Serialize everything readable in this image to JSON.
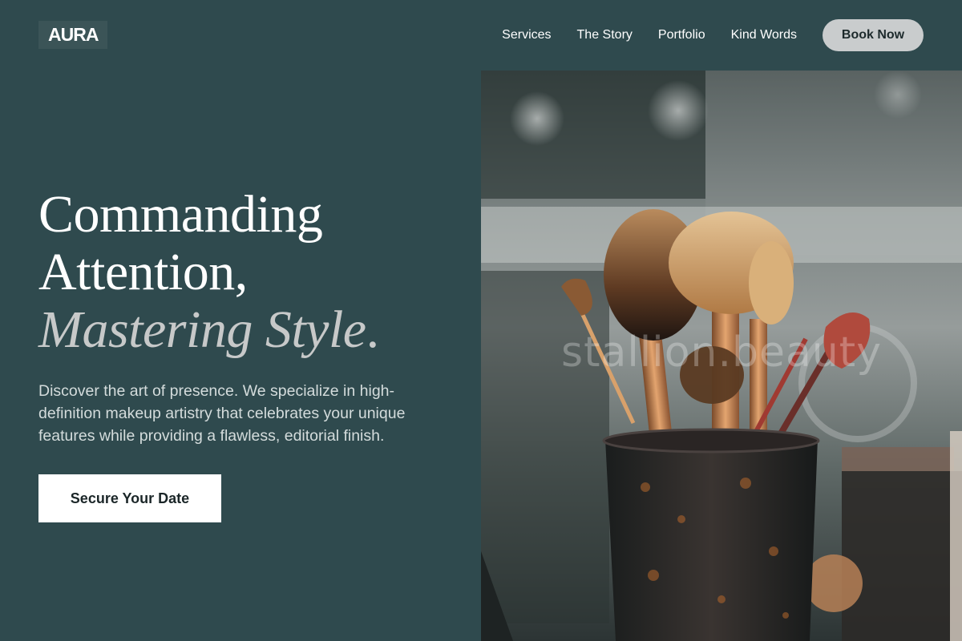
{
  "brand": {
    "logo_text": "AURA"
  },
  "nav": {
    "links": [
      "Services",
      "The Story",
      "Portfolio",
      "Kind Words"
    ],
    "cta_label": "Book Now"
  },
  "hero": {
    "headline_line1": "Commanding",
    "headline_line2": "Attention,",
    "headline_accent": "Mastering Style",
    "headline_period": ".",
    "lead": "Discover the art of presence. We specialize in high-definition makeup artistry that celebrates your unique features while providing a flawless, editorial finish.",
    "cta_label": "Secure Your Date",
    "image": {
      "subject": "makeup brushes in a cup",
      "watermark": "stallion.beauty"
    }
  },
  "colors": {
    "background": "#2f4a4e",
    "logo_bg": "#3b5457",
    "book_button_bg": "#c9cccd",
    "cta_bg": "#ffffff",
    "accent_text": "#c7c9c9"
  }
}
